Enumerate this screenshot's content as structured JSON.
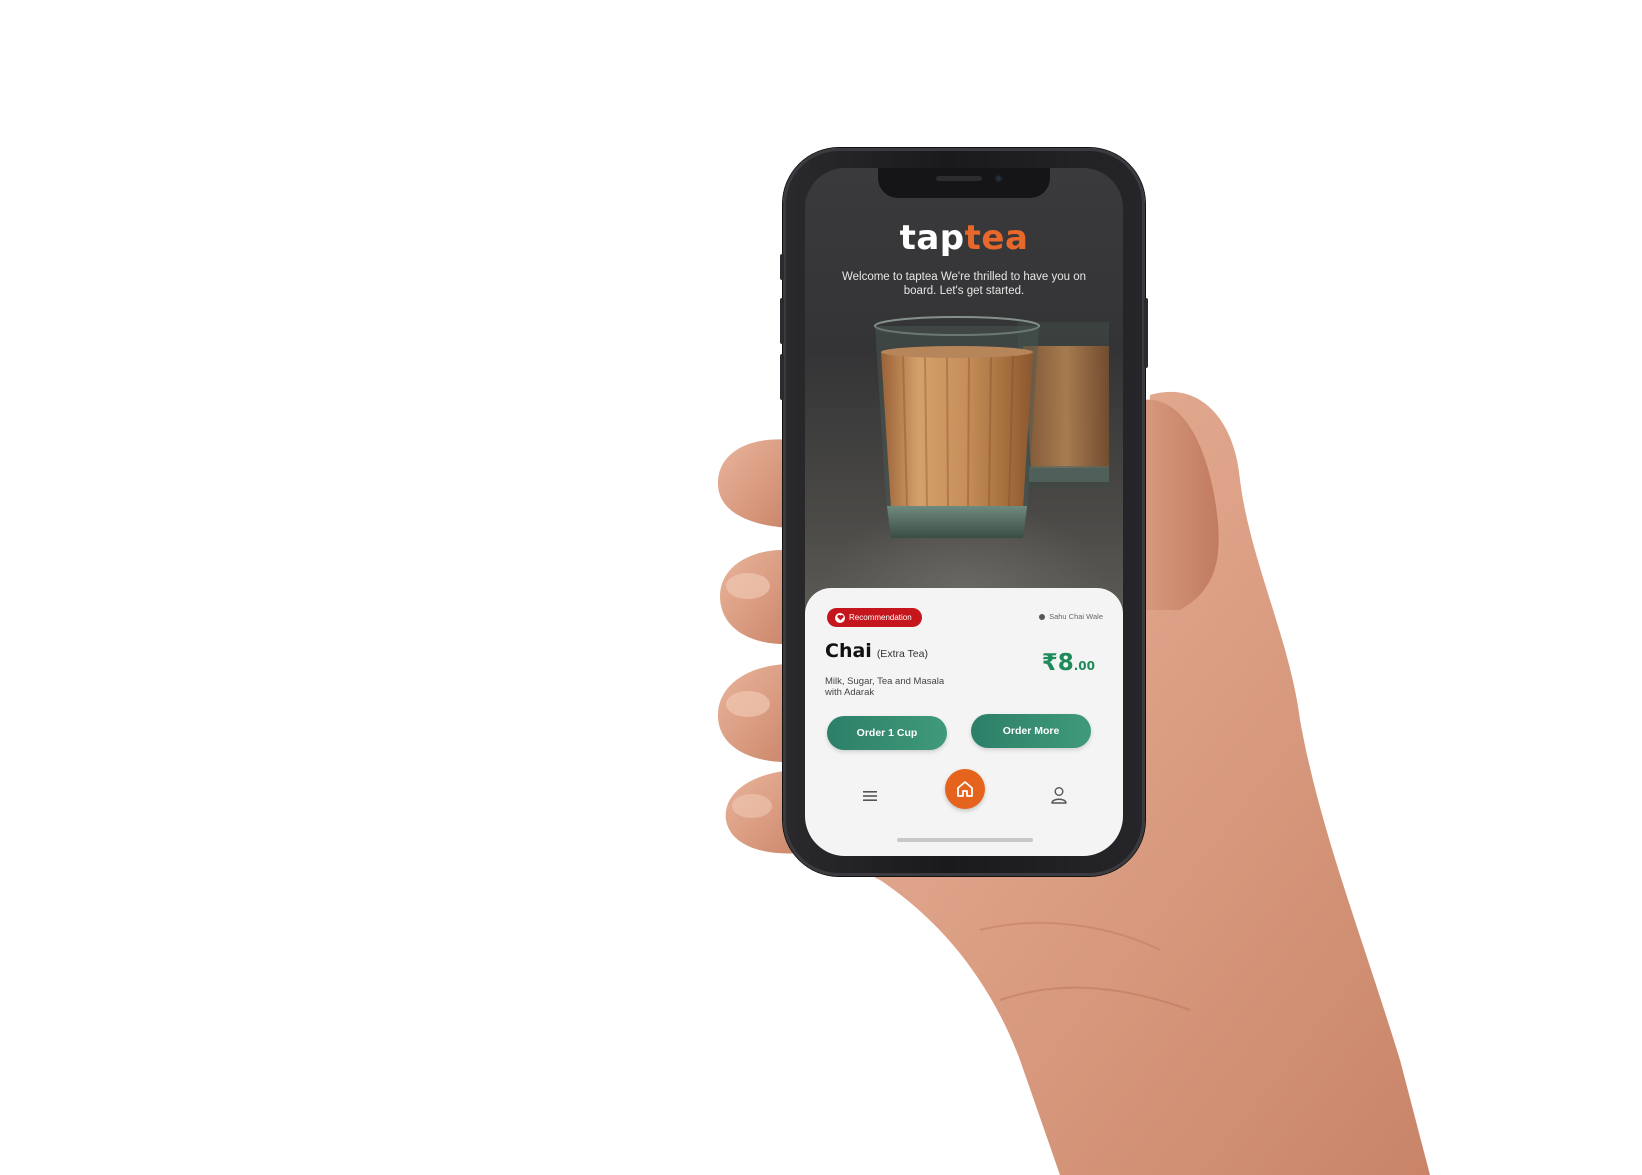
{
  "app": {
    "logo_tap": "tap",
    "logo_tea": "tea",
    "welcome_text": "Welcome to taptea We're thrilled to have you on board. Let's get started."
  },
  "card": {
    "badge_label": "Recommendation",
    "vendor": "Sahu Chai Wale",
    "item_name": "Chai",
    "item_variant": "(Extra Tea)",
    "item_description": "Milk, Sugar, Tea and Masala with Adarak",
    "price_main": "₹8",
    "price_decimal": ".00",
    "order_one_label": "Order 1 Cup",
    "order_more_label": "Order More"
  },
  "nav": {
    "menu_icon": "menu-icon",
    "home_icon": "home-icon",
    "user_icon": "user-icon"
  },
  "colors": {
    "accent_orange": "#e5631d",
    "badge_red": "#c4161c",
    "price_green": "#1f8a5a",
    "button_green": "#2d7f68"
  }
}
